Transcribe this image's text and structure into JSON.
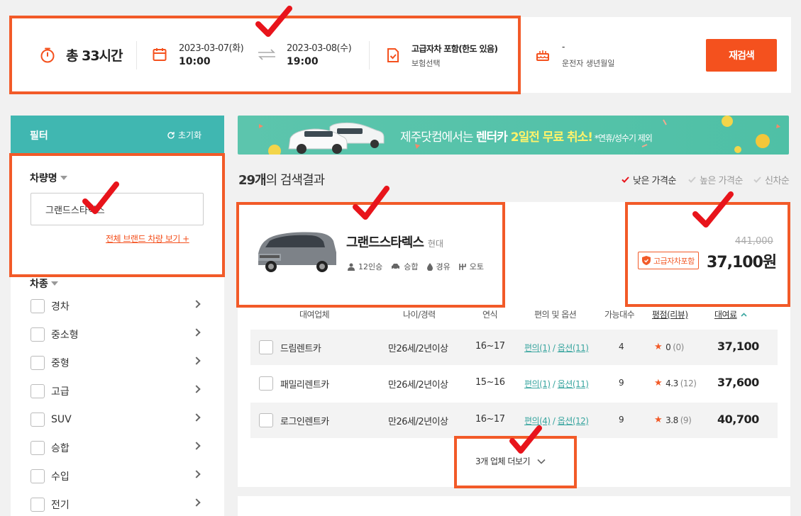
{
  "search": {
    "total_time": "총 33시간",
    "start_date": "2023-03-07(화)",
    "start_time": "10:00",
    "end_date": "2023-03-08(수)",
    "end_time": "19:00",
    "insurance_title": "고급자차 포함(한도 있음)",
    "insurance_sub": "보험선택",
    "birth_value": "-",
    "birth_label": "운전자 생년월일",
    "research_button": "재검색"
  },
  "filter": {
    "title": "필터",
    "reset": "초기화",
    "car_name_label": "차량명",
    "car_name_value": "그랜드스타렉스",
    "all_brands_link": "전체 브랜드 차량 보기 +",
    "car_type_label": "차종",
    "car_types": [
      "경차",
      "중소형",
      "중형",
      "고급",
      "SUV",
      "승합",
      "수입",
      "전기"
    ]
  },
  "banner": {
    "prefix": "제주닷컴에서는 ",
    "bold1": "렌터카 ",
    "highlight": "2일전 무료 취소!",
    "note": " *연휴/성수기 제외"
  },
  "results": {
    "count": "29개",
    "count_suffix": "의 검색결과",
    "sort": [
      "낮은 가격순",
      "높은 가격순",
      "신차순"
    ]
  },
  "car": {
    "name": "그랜드스타렉스",
    "brand": "현대",
    "specs": [
      "12인승",
      "승합",
      "경유",
      "오토"
    ],
    "original_price": "441,000",
    "insurance_badge": "고급자차포함",
    "price": "37,100원"
  },
  "table": {
    "headers": [
      "대여업체",
      "나이/경력",
      "연식",
      "편의 및 옵션",
      "가능대수",
      "평점(리뷰)",
      "대여료"
    ],
    "rows": [
      {
        "company": "드림렌트카",
        "age": "만26세/2년이상",
        "year": "16~17",
        "conv": "편의(1)",
        "opt": "옵션(11)",
        "count": "4",
        "rating": "0",
        "reviews": "(0)",
        "price": "37,100"
      },
      {
        "company": "패밀리렌트카",
        "age": "만26세/2년이상",
        "year": "15~16",
        "conv": "편의(1)",
        "opt": "옵션(11)",
        "count": "9",
        "rating": "4.3",
        "reviews": "(12)",
        "price": "37,600"
      },
      {
        "company": "로그인렌트카",
        "age": "만26세/2년이상",
        "year": "16~17",
        "conv": "편의(4)",
        "opt": "옵션(12)",
        "count": "9",
        "rating": "3.8",
        "reviews": "(9)",
        "price": "40,700"
      }
    ],
    "more": "3개 업체 더보기"
  },
  "colors": {
    "accent": "#f4511e",
    "teal": "#40b7b1",
    "annotation": "#f25a28",
    "check": "#e8141b"
  }
}
